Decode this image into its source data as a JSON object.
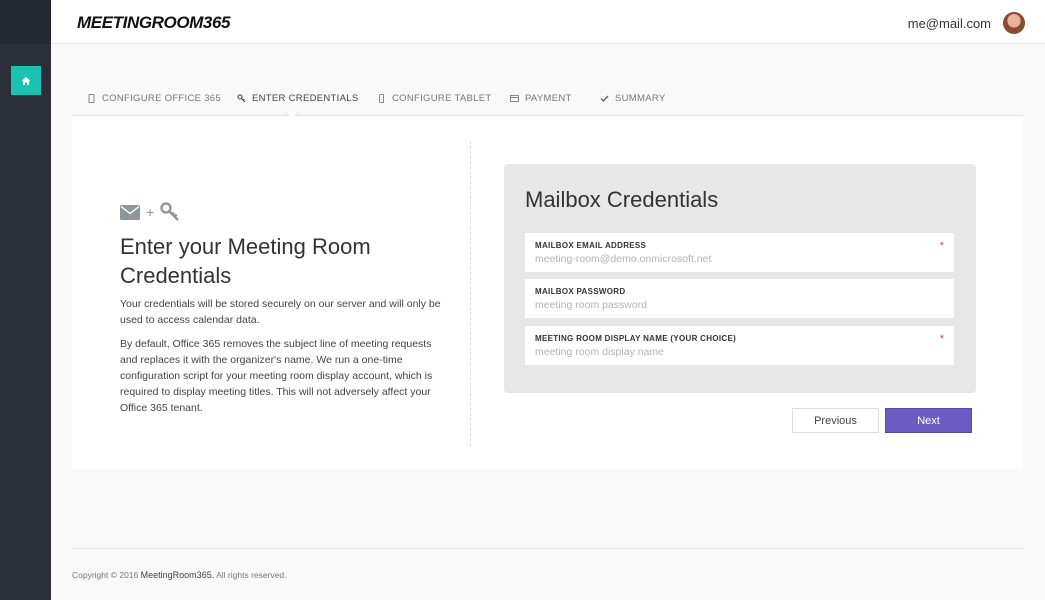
{
  "app": {
    "logo": "MEETINGROOM365",
    "user_email": "me@mail.com"
  },
  "tabs": [
    {
      "label": "CONFIGURE OFFICE 365",
      "icon": "tablet-icon"
    },
    {
      "label": "ENTER CREDENTIALS",
      "icon": "key-icon",
      "active": true
    },
    {
      "label": "CONFIGURE TABLET",
      "icon": "phone-icon"
    },
    {
      "label": "PAYMENT",
      "icon": "credit-card-icon"
    },
    {
      "label": "SUMMARY",
      "icon": "check-icon"
    }
  ],
  "left": {
    "icons": [
      "envelope-icon",
      "plus",
      "key-icon"
    ],
    "plus": "+",
    "title_line1": "Enter your Meeting Room",
    "title_line2": "Credentials",
    "p1": "Your credentials will be stored securely on our server and will only be used to access calendar data.",
    "p2": "By default, Office 365 removes the subject line of meeting requests and replaces it with the organizer's name. We run a one-time configuration script for your meeting room display account, which is required to display meeting titles. This will not adversely affect your Office 365 tenant."
  },
  "form": {
    "title": "Mailbox Credentials",
    "fields": [
      {
        "label": "MAILBOX EMAIL ADDRESS",
        "placeholder": "meeting-room@demo.onmicrosoft.net",
        "value": "",
        "required": "*"
      },
      {
        "label": "MAILBOX PASSWORD",
        "placeholder": "meeting room password",
        "value": "",
        "required": ""
      },
      {
        "label": "MEETING ROOM DISPLAY NAME (YOUR CHOICE)",
        "placeholder": "meeting room display name",
        "value": "",
        "required": "*"
      }
    ],
    "previous_label": "Previous",
    "next_label": "Next"
  },
  "footer": {
    "prefix": "Copyright © 2016",
    "brand": "MeetingRoom365.",
    "suffix": "All rights reserved."
  },
  "colors": {
    "accent": "#6c5cc1",
    "home": "#19c3b0",
    "sidebar": "#2a2f3a",
    "required": "#e2433b"
  }
}
